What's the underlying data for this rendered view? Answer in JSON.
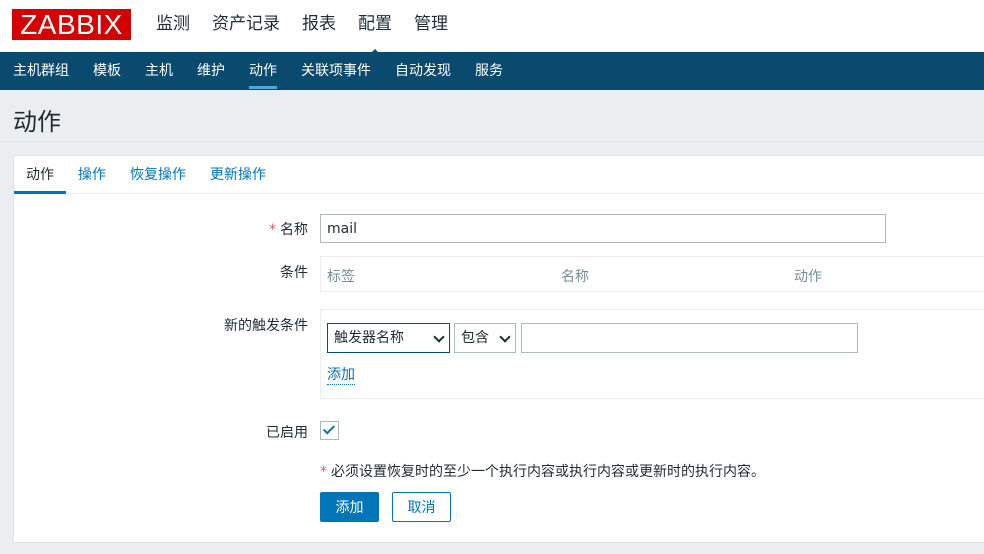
{
  "logo": "ZABBIX",
  "main_nav": [
    "监测",
    "资产记录",
    "报表",
    "配置",
    "管理"
  ],
  "sub_nav": [
    "主机群组",
    "模板",
    "主机",
    "维护",
    "动作",
    "关联项事件",
    "自动发现",
    "服务"
  ],
  "page_title": "动作",
  "tabs": [
    "动作",
    "操作",
    "恢复操作",
    "更新操作"
  ],
  "form": {
    "name_label": "名称",
    "name_value": "mail",
    "required_mark": "*",
    "conditions_label": "条件",
    "conditions_columns": [
      "标签",
      "名称",
      "动作"
    ],
    "new_condition_label": "新的触发条件",
    "condition_type": "触发器名称",
    "condition_operator": "包含",
    "condition_value": "",
    "add_link": "添加",
    "enabled_label": "已启用",
    "enabled": true,
    "note": "必须设置恢复时的至少一个执行内容或执行内容或更新时的执行内容。",
    "add_button": "添加",
    "cancel_button": "取消"
  },
  "colors": {
    "brand": "#d40000",
    "nav_bg": "#0b4a6f",
    "accent": "#0275b8",
    "required": "#e45959"
  }
}
